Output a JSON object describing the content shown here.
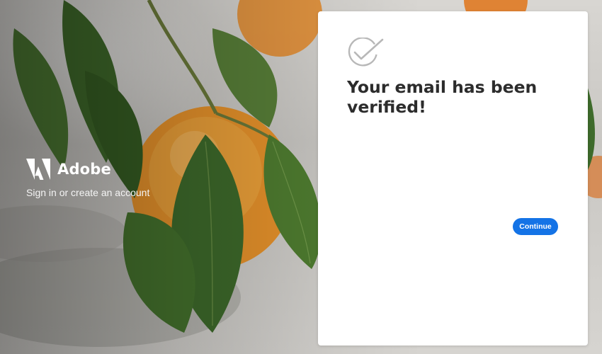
{
  "brand": {
    "name": "Adobe",
    "tagline": "Sign in or create an account",
    "logo_icon": "adobe-logo-icon"
  },
  "card": {
    "icon": "check-circle-icon",
    "title": "Your email has been verified!",
    "continue_label": "Continue"
  },
  "colors": {
    "accent": "#1473e6",
    "title": "#2c2c2c",
    "check_icon": "#b8b8b8",
    "card_bg": "#ffffff"
  }
}
